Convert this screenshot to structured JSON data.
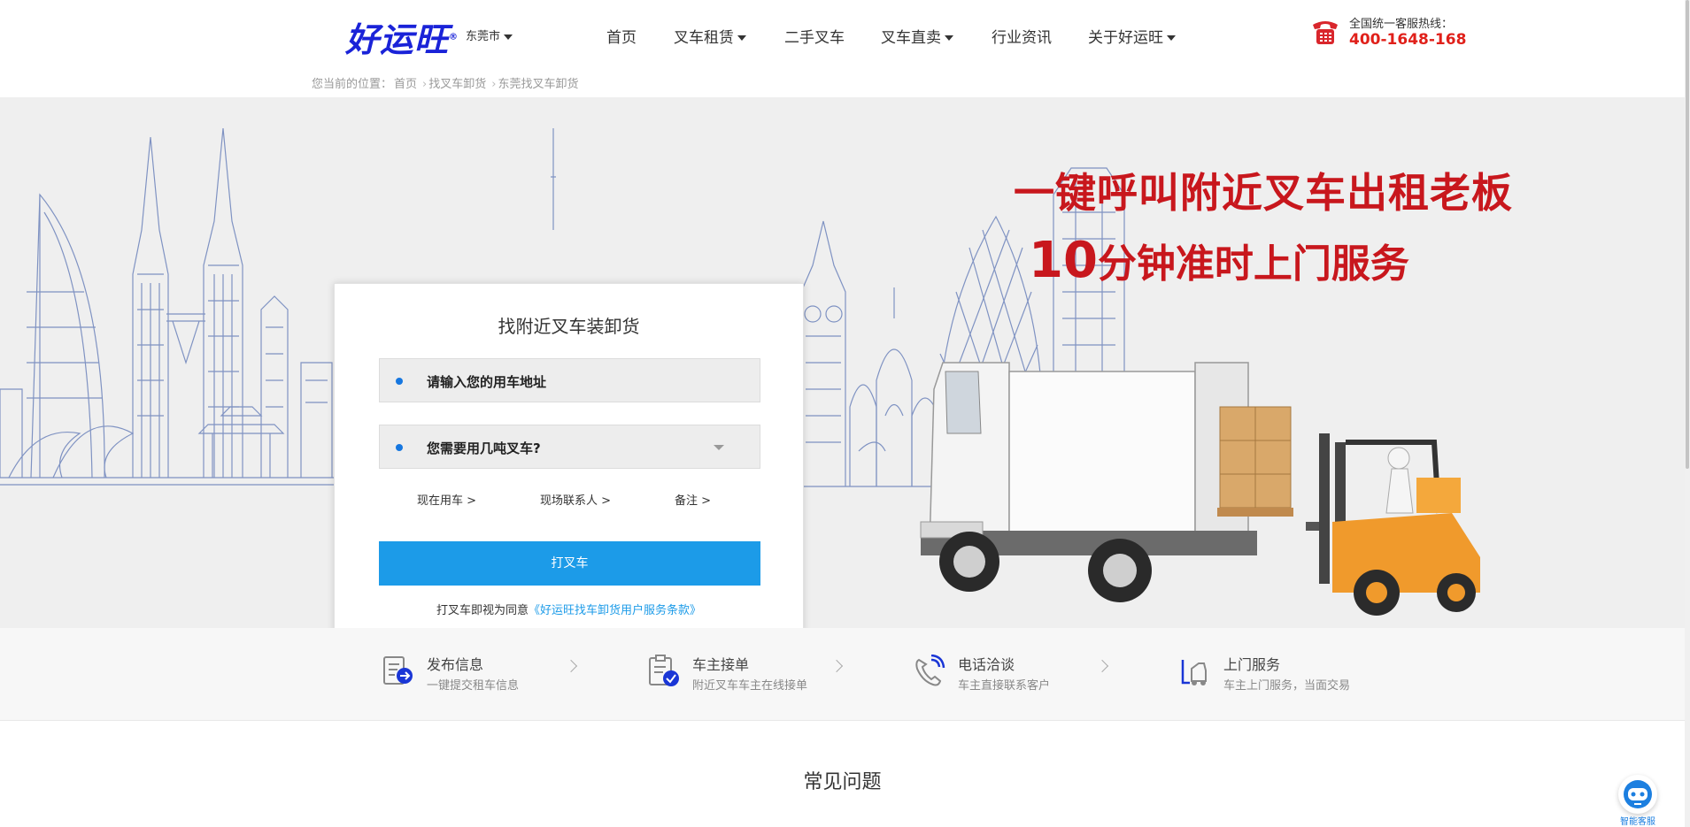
{
  "header": {
    "logo": "好运旺",
    "logo_mark": "®",
    "city": "东莞市",
    "nav": [
      {
        "label": "首页",
        "dropdown": false
      },
      {
        "label": "叉车租赁",
        "dropdown": true
      },
      {
        "label": "二手叉车",
        "dropdown": false
      },
      {
        "label": "叉车直卖",
        "dropdown": true
      },
      {
        "label": "行业资讯",
        "dropdown": false
      },
      {
        "label": "关于好运旺",
        "dropdown": true
      }
    ],
    "hotline_title": "全国统一客服热线：",
    "hotline_number": "400-1648-168"
  },
  "breadcrumb": {
    "prefix": "您当前的位置：",
    "items": [
      "首页",
      "找叉车卸货",
      "东莞找叉车卸货"
    ]
  },
  "hero": {
    "slogan_line1": "一键呼叫附近叉车出租老板",
    "slogan_line2_num": "10",
    "slogan_line2_text": "分钟准时上门服务"
  },
  "form": {
    "title": "找附近叉车装卸货",
    "address_placeholder": "请输入您的用车地址",
    "tonnage_placeholder": "您需要用几吨叉车?",
    "options": [
      "现在用车 >",
      "现场联系人 >",
      "备注 >"
    ],
    "submit_label": "打叉车",
    "agree_text": "打叉车即视为同意",
    "agree_link": "《好运旺找车卸货用户服务条款》"
  },
  "steps": [
    {
      "title": "发布信息",
      "sub": "一键提交租车信息",
      "icon": "publish-icon"
    },
    {
      "title": "车主接单",
      "sub": "附近叉车车主在线接单",
      "icon": "order-icon"
    },
    {
      "title": "电话洽谈",
      "sub": "车主直接联系客户",
      "icon": "phone-call-icon"
    },
    {
      "title": "上门服务",
      "sub": "车主上门服务，当面交易",
      "icon": "forklift-icon"
    }
  ],
  "faq_title": "常见问题",
  "chat_label": "智能客服",
  "colors": {
    "logo": "#1a23d8",
    "accent_red": "#c8171d",
    "hotline_red": "#e0201a",
    "button_blue": "#1c9be8",
    "dot_blue": "#1677e0"
  }
}
